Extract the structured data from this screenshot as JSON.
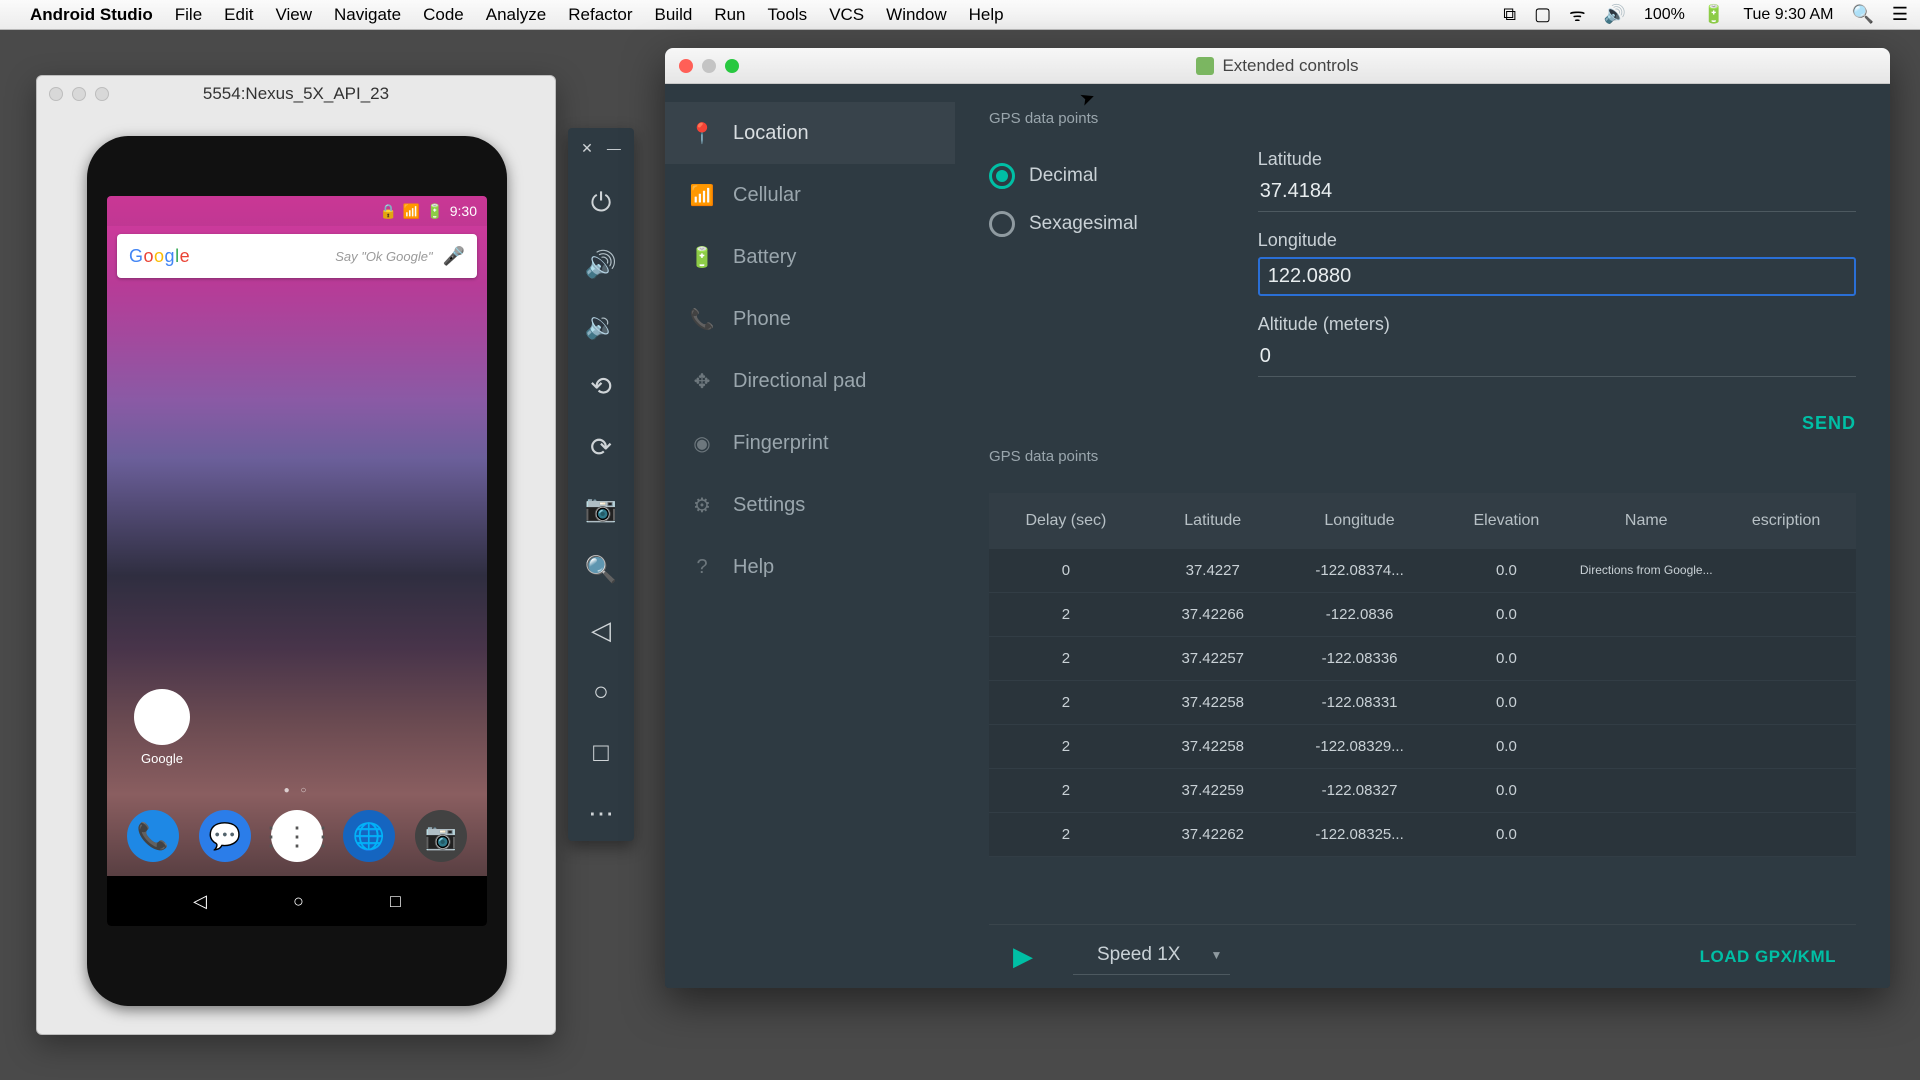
{
  "menubar": {
    "app": "Android Studio",
    "items": [
      "File",
      "Edit",
      "View",
      "Navigate",
      "Code",
      "Analyze",
      "Refactor",
      "Build",
      "Run",
      "Tools",
      "VCS",
      "Window",
      "Help"
    ],
    "battery": "100%",
    "clock": "Tue 9:30 AM"
  },
  "emulator": {
    "title": "5554:Nexus_5X_API_23",
    "status_time": "9:30",
    "search_hint": "Say \"Ok Google\"",
    "google_label": "Google"
  },
  "ext": {
    "title": "Extended controls",
    "categories": [
      {
        "icon": "📍",
        "label": "Location",
        "active": true
      },
      {
        "icon": "📶",
        "label": "Cellular"
      },
      {
        "icon": "🔋",
        "label": "Battery"
      },
      {
        "icon": "📞",
        "label": "Phone"
      },
      {
        "icon": "✥",
        "label": "Directional pad"
      },
      {
        "icon": "◉",
        "label": "Fingerprint"
      },
      {
        "icon": "⚙",
        "label": "Settings"
      },
      {
        "icon": "?",
        "label": "Help"
      }
    ],
    "gps_heading": "GPS data points",
    "format": {
      "decimal": "Decimal",
      "sexagesimal": "Sexagesimal"
    },
    "fields": {
      "lat_label": "Latitude",
      "lat_value": "37.4184",
      "lon_label": "Longitude",
      "lon_value": "122.0880",
      "alt_label": "Altitude (meters)",
      "alt_value": "0"
    },
    "send": "SEND",
    "table": {
      "headers": [
        "Delay (sec)",
        "Latitude",
        "Longitude",
        "Elevation",
        "Name",
        "escription"
      ],
      "rows": [
        {
          "delay": "0",
          "lat": "37.4227",
          "lon": "-122.08374...",
          "elev": "0.0",
          "name": "Directions from Google...",
          "desc": ""
        },
        {
          "delay": "2",
          "lat": "37.42266",
          "lon": "-122.0836",
          "elev": "0.0",
          "name": "",
          "desc": ""
        },
        {
          "delay": "2",
          "lat": "37.42257",
          "lon": "-122.08336",
          "elev": "0.0",
          "name": "",
          "desc": ""
        },
        {
          "delay": "2",
          "lat": "37.42258",
          "lon": "-122.08331",
          "elev": "0.0",
          "name": "",
          "desc": ""
        },
        {
          "delay": "2",
          "lat": "37.42258",
          "lon": "-122.08329...",
          "elev": "0.0",
          "name": "",
          "desc": ""
        },
        {
          "delay": "2",
          "lat": "37.42259",
          "lon": "-122.08327",
          "elev": "0.0",
          "name": "",
          "desc": ""
        },
        {
          "delay": "2",
          "lat": "37.42262",
          "lon": "-122.08325...",
          "elev": "0.0",
          "name": "",
          "desc": ""
        }
      ]
    },
    "speed": "Speed 1X",
    "load": "LOAD GPX/KML"
  }
}
